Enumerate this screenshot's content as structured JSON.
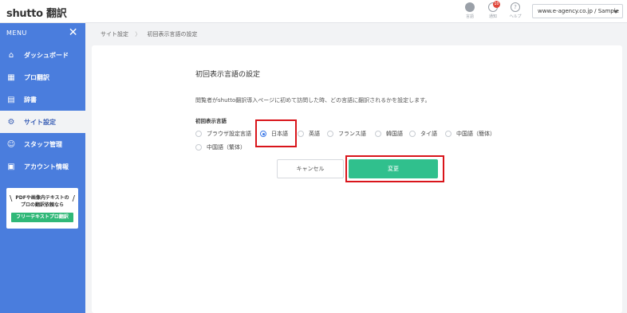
{
  "header": {
    "logo": "shutto 翻訳",
    "icons": [
      {
        "name": "globe-icon",
        "label": "言語"
      },
      {
        "name": "bell-icon",
        "label": "通知",
        "badge": "10"
      },
      {
        "name": "help-icon",
        "label": "ヘルプ",
        "glyph": "?"
      }
    ],
    "site_select": "www.e-agency.co.jp / Sample"
  },
  "sidebar": {
    "menu_label": "MENU",
    "close_glyph": "✕",
    "items": [
      {
        "label": "ダッシュボード",
        "icon": "home-icon",
        "glyph": "⌂",
        "active": false
      },
      {
        "label": "プロ翻訳",
        "icon": "table-icon",
        "glyph": "▦",
        "active": false
      },
      {
        "label": "辞書",
        "icon": "book-icon",
        "glyph": "▤",
        "active": false
      },
      {
        "label": "サイト設定",
        "icon": "gear-icon",
        "glyph": "⚙",
        "active": true
      },
      {
        "label": "スタッフ管理",
        "icon": "staff-icon",
        "glyph": "☺",
        "active": false
      },
      {
        "label": "アカウント情報",
        "icon": "account-icon",
        "glyph": "▣",
        "active": false
      }
    ],
    "promo": {
      "line1": "PDFや画像内テキストの",
      "line2": "プロの翻訳依頼なら",
      "button": "フリーテキストプロ翻訳"
    }
  },
  "breadcrumb": {
    "items": [
      "サイト設定",
      "初回表示言語の設定"
    ],
    "separator": "〉"
  },
  "main": {
    "title": "初回表示言語の設定",
    "description": "閲覧者がshutto翻訳導入ページに初めて訪問した時、どの言語に翻訳されるかを設定します。",
    "field_label": "初回表示言語",
    "options": [
      "ブラウザ設定言語",
      "日本語",
      "英語",
      "フランス語",
      "韓国語",
      "タイ語",
      "中国語（簡体）",
      "中国語（繁体）"
    ],
    "selected": "日本語",
    "cancel_label": "キャンセル",
    "save_label": "変更"
  },
  "colors": {
    "sidebar": "#4a7ddd",
    "save_button": "#30c08d",
    "highlight": "#d9151b",
    "radio_checked": "#3b78e7"
  }
}
